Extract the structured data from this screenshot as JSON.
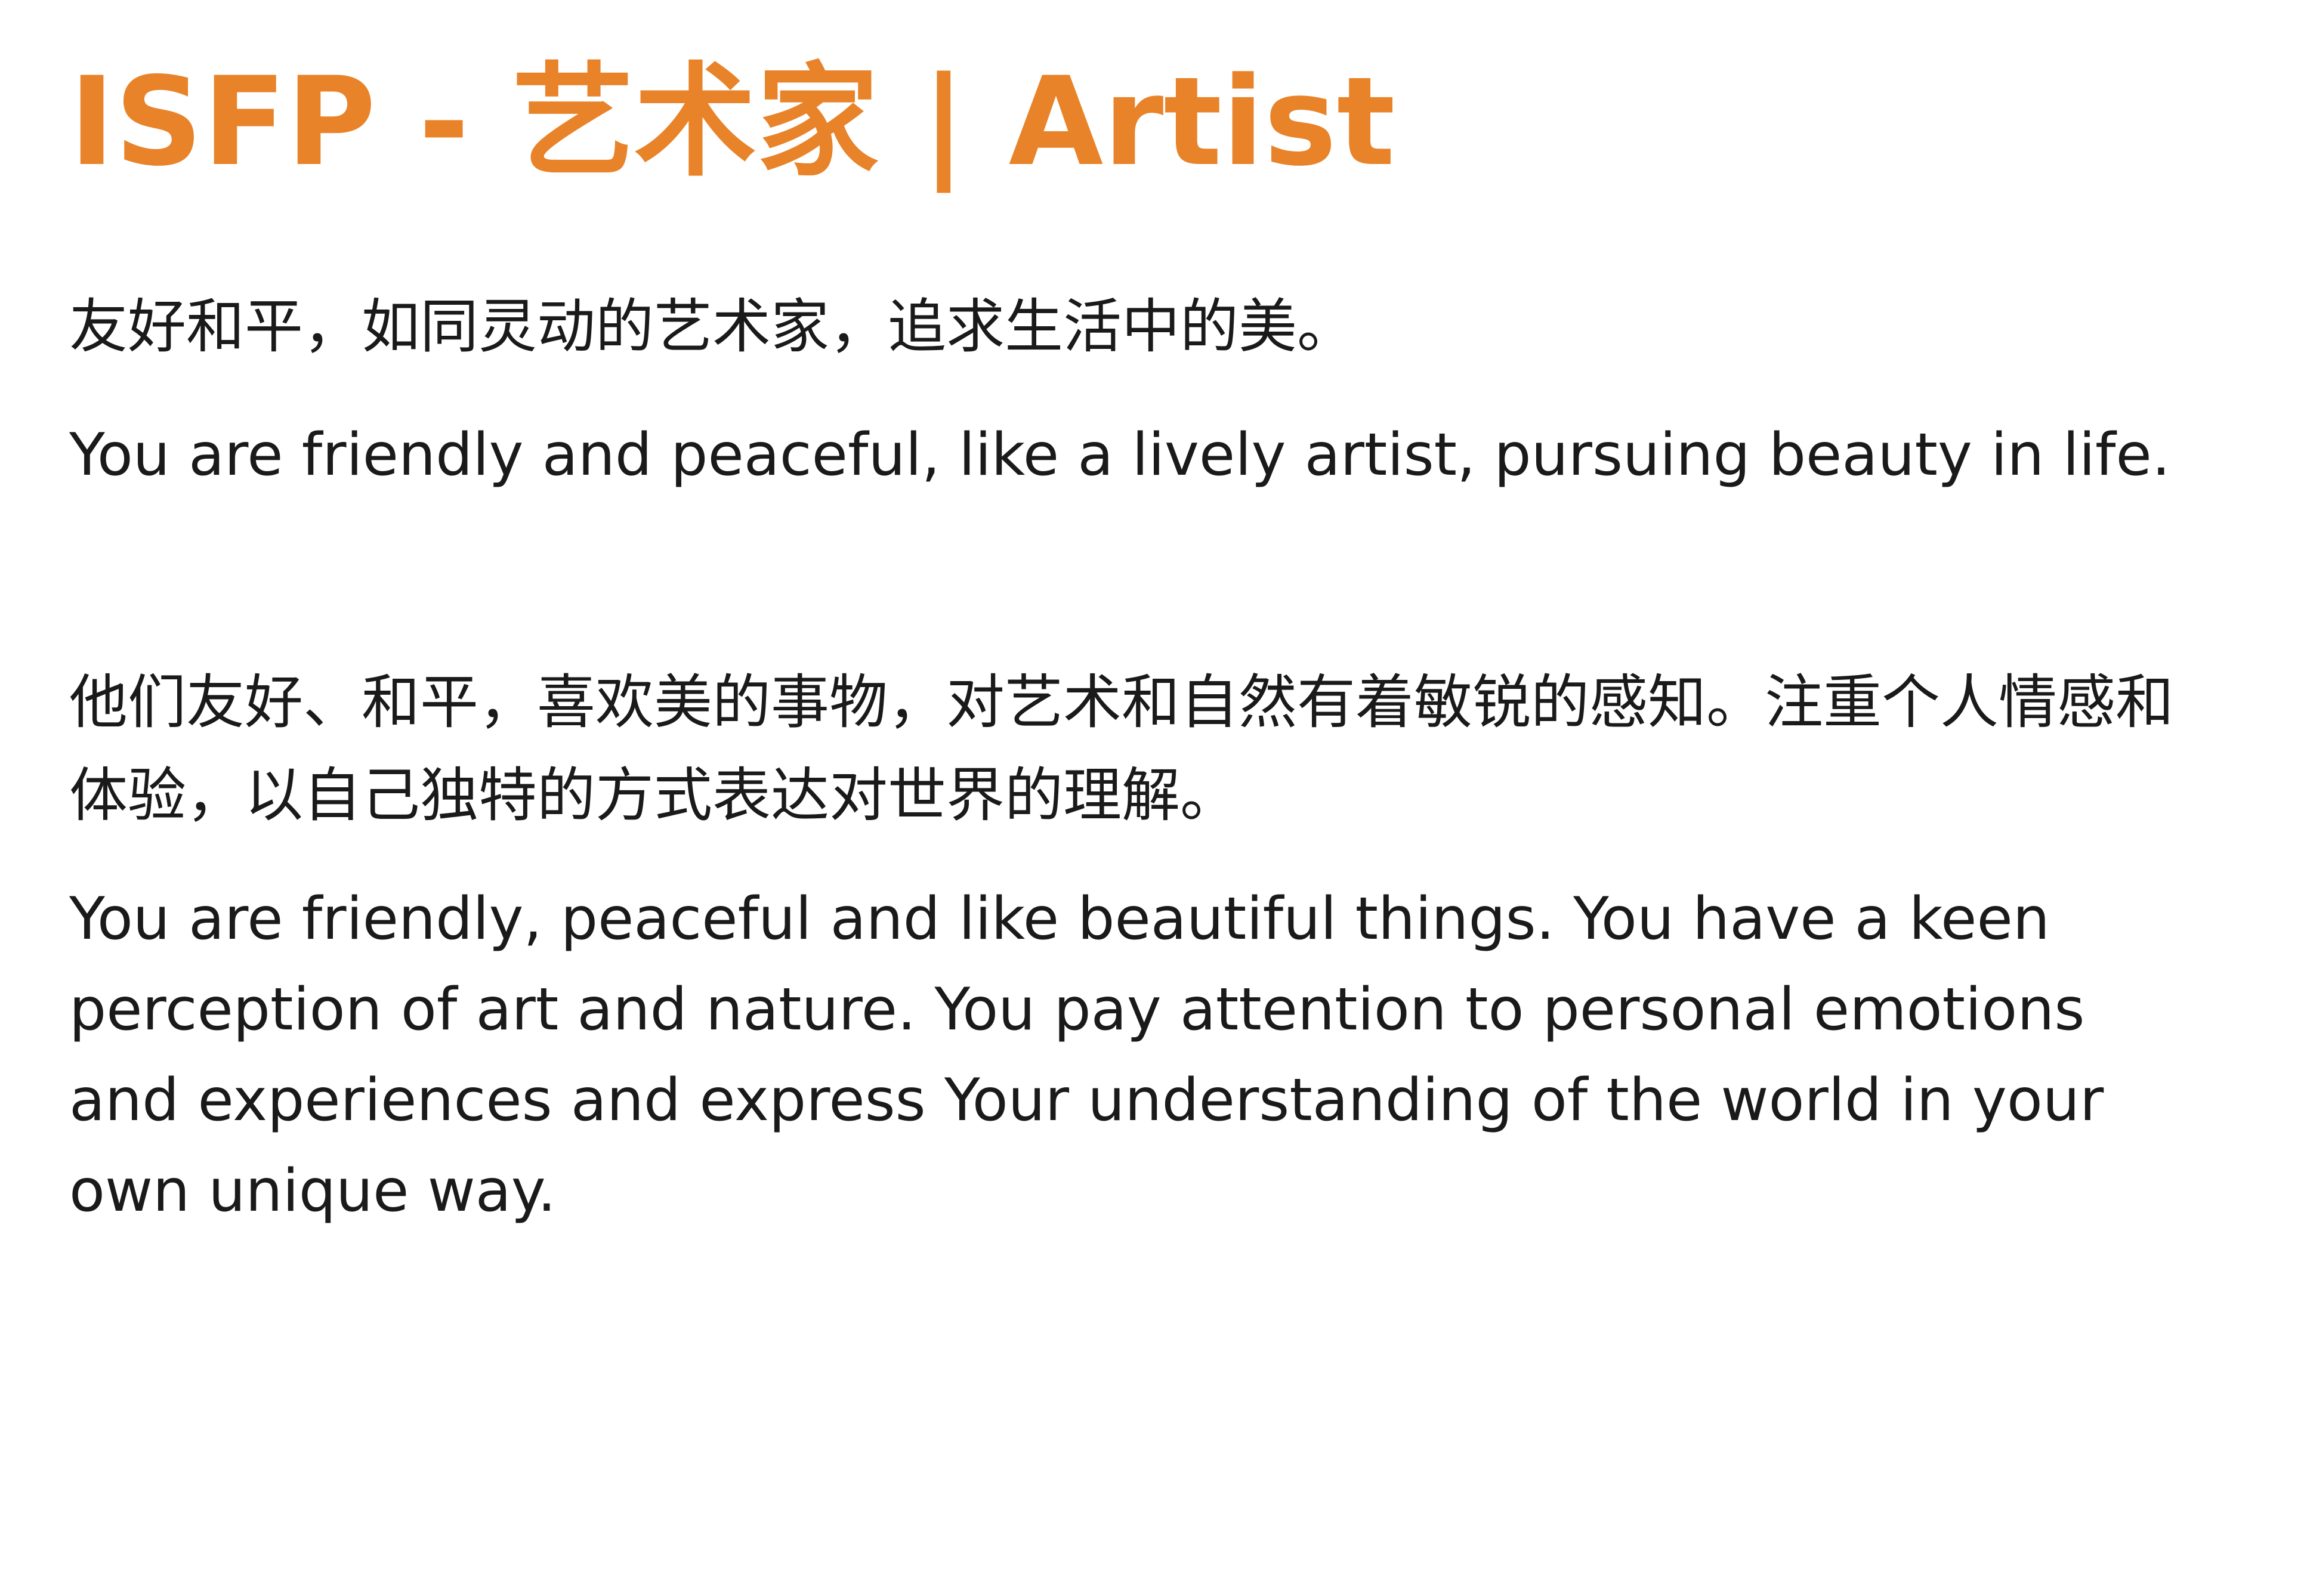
{
  "header": {
    "title": "ISFP - 艺术家 | Artist",
    "accent_color": "#E8832A"
  },
  "intro": {
    "summary_zh": "友好和平，如同灵动的艺术家，追求生活中的美。",
    "summary_en": "You are friendly and peaceful, like a lively artist, pursuing beauty in life."
  },
  "details": {
    "description_zh": "他们友好、和平，喜欢美的事物，对艺术和自然有着敏锐的感知。注重个人情感和体验，以自己独特的方式表达对世界的理解。",
    "description_en": "You are friendly, peaceful and like beautiful things. You have a keen perception of art and nature. You pay attention to personal emotions and experiences and express Your understanding of the world in your own unique way."
  },
  "colors": {
    "text": "#1A1A1A",
    "background": "#FFFFFF"
  }
}
